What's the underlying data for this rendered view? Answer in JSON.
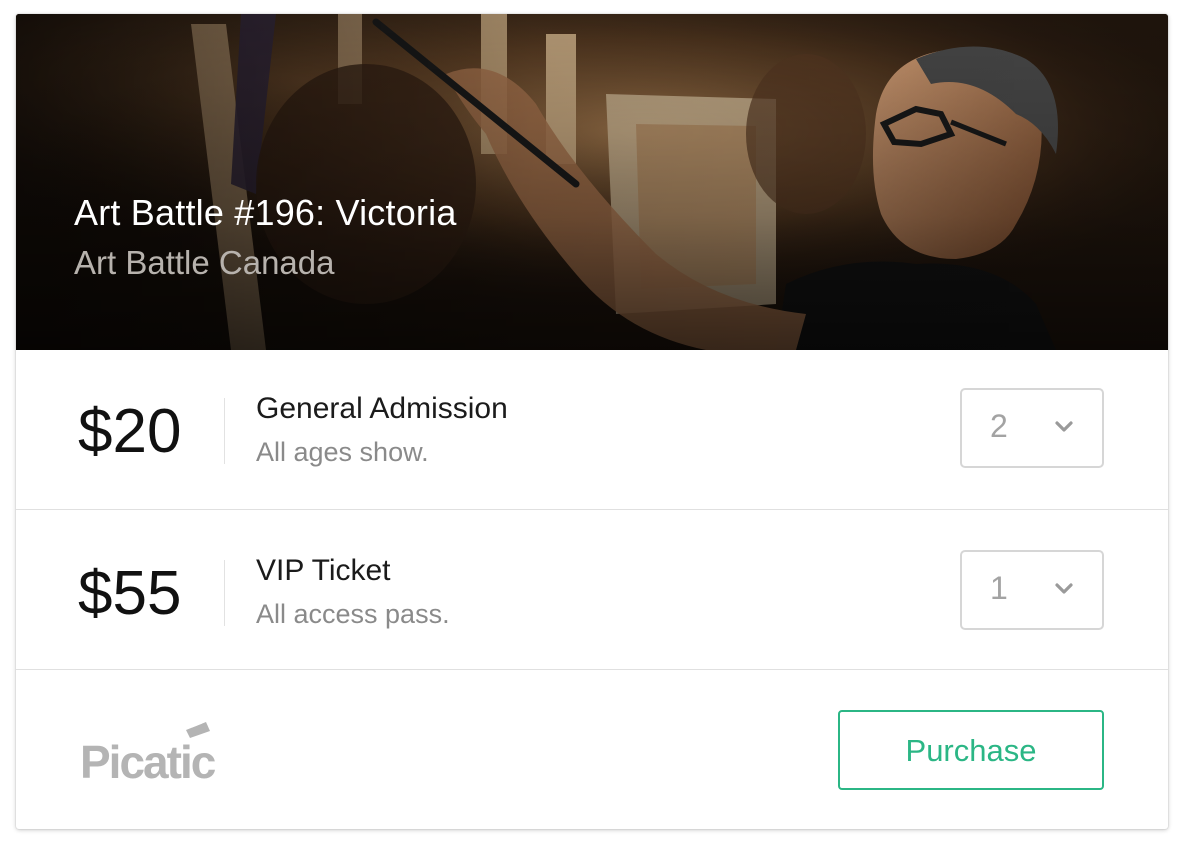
{
  "event": {
    "title": "Art Battle #196: Victoria",
    "organizer": "Art Battle Canada"
  },
  "tickets": [
    {
      "price": "$20",
      "name": "General Admission",
      "description": "All ages show.",
      "quantity": "2"
    },
    {
      "price": "$55",
      "name": "VIP Ticket",
      "description": "All access pass.",
      "quantity": "1"
    }
  ],
  "footer": {
    "brand": "Picatic",
    "purchase_label": "Purchase"
  },
  "icons": {
    "select_arrow": "chevron-down-icon",
    "logo": "picatic-logo"
  },
  "colors": {
    "accent": "#2bb685",
    "logo_gray": "#b4b4b4"
  }
}
